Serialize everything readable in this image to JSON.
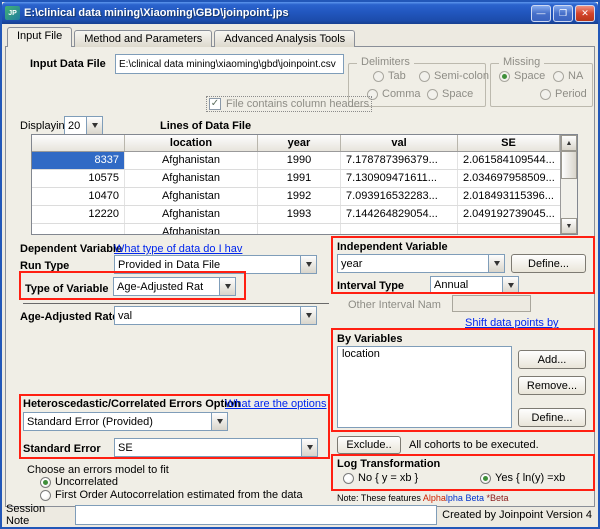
{
  "window": {
    "icon_text": "JP",
    "title": "E:\\clinical data mining\\Xiaoming\\GBD\\joinpoint.jps"
  },
  "icons": {
    "minimize": "—",
    "restore": "❐",
    "close": "✕",
    "arrow_up": "▲",
    "arrow_down": "▼",
    "check": "✓"
  },
  "tabs": {
    "input_file": "Input File",
    "method": "Method and Parameters",
    "advanced": "Advanced Analysis Tools"
  },
  "file_row": {
    "label": "Input Data File",
    "value": "E:\\clinical data mining\\xiaoming\\gbd\\joinpoint.csv"
  },
  "delimiters": {
    "legend": "Delimiters",
    "tab": "Tab",
    "semicolon": "Semi-colon",
    "comma": "Comma",
    "space": "Space"
  },
  "missing": {
    "legend": "Missing",
    "space": "Space",
    "na": "NA",
    "period": "Period",
    "space_selected": true
  },
  "headers_checkbox": {
    "label": "File contains column headers",
    "checked": true
  },
  "display_row": {
    "label": "Displaying",
    "value": "20",
    "table_title": "Lines of Data File"
  },
  "table": {
    "columns": [
      "",
      "location",
      "year",
      "val",
      "SE"
    ],
    "rows": [
      [
        "8337",
        "Afghanistan",
        "1990",
        "7.178787396379...",
        "2.061584109544..."
      ],
      [
        "10575",
        "Afghanistan",
        "1991",
        "7.130909471611...",
        "2.034697958509..."
      ],
      [
        "10470",
        "Afghanistan",
        "1992",
        "7.093916532283...",
        "2.018493115396..."
      ],
      [
        "12220",
        "Afghanistan",
        "1993",
        "7.144264829054...",
        "2.049192739045..."
      ],
      [
        "",
        "Afghanistan",
        "",
        "",
        ""
      ]
    ]
  },
  "dependent": {
    "title": "Dependent Variable",
    "help_link": "What type of data do I hav",
    "run_type_label": "Run Type",
    "run_type_value": "Provided in Data File",
    "type_label": "Type of Variable",
    "type_value": "Age-Adjusted Rat",
    "rate_label": "Age-Adjusted Rate",
    "rate_value": "val"
  },
  "independent": {
    "title": "Independent Variable",
    "value": "year",
    "define_button": "Define...",
    "interval_label": "Interval Type",
    "interval_value": "Annual",
    "other_label": "Other Interval Nam",
    "shift_link": "Shift data points by"
  },
  "by_variables": {
    "title": "By Variables",
    "items": [
      "location"
    ],
    "add_button": "Add...",
    "remove_button": "Remove...",
    "define_button": "Define...",
    "exclude_button": "Exclude..",
    "exclude_note": "All cohorts to be executed."
  },
  "errors_option": {
    "title": "Heteroscedastic/Correlated Errors Option",
    "help_link": "What are the options",
    "value": "Standard Error (Provided)",
    "se_label": "Standard Error",
    "se_value": "SE"
  },
  "errors_model": {
    "title": "Choose an errors model to fit",
    "uncorrelated": "Uncorrelated",
    "autocorrelated": "First Order Autocorrelation estimated from the data",
    "uncorrelated_selected": true
  },
  "log_transform": {
    "title": "Log Transformation",
    "no_label": "No { y = xb }",
    "yes_label": "Yes { ln(y) =xb",
    "yes_selected": true
  },
  "note": {
    "prefix": "Note: These features ",
    "alpha": "Alpha",
    "beta": "lpha Beta",
    "suffix": " *Beta"
  },
  "session": {
    "label": "Session Note",
    "value": ""
  },
  "footer": {
    "credit": "Created by Joinpoint Version 4"
  }
}
